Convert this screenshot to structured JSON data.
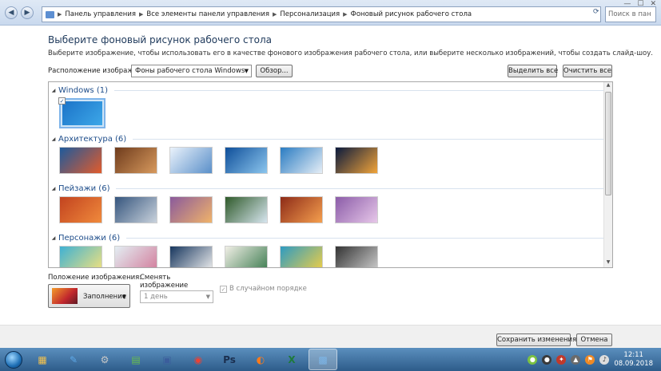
{
  "address": {
    "segments": [
      "Панель управления",
      "Все элементы панели управления",
      "Персонализация",
      "Фоновый рисунок рабочего стола"
    ],
    "search_placeholder": "Поиск в пан"
  },
  "main": {
    "title": "Выберите фоновый рисунок рабочего стола",
    "subtitle": "Выберите изображение, чтобы использовать его в качестве фонового изображения рабочего стола, или выберите несколько изображений, чтобы создать слайд-шоу.",
    "location_label": "Расположение изображения:",
    "location_value": "Фоны рабочего стола Windows",
    "browse_label": "Обзор...",
    "select_all_label": "Выделить все",
    "clear_all_label": "Очистить все"
  },
  "groups": [
    {
      "title": "Windows (1)",
      "thumbs": [
        {
          "colors": [
            "#1b73c8",
            "#3da7e8"
          ],
          "selected": true
        }
      ]
    },
    {
      "title": "Архитектура (6)",
      "thumbs": [
        {
          "colors": [
            "#1d5a9c",
            "#e25b2b"
          ]
        },
        {
          "colors": [
            "#6e3b1c",
            "#d89a5e"
          ]
        },
        {
          "colors": [
            "#eaf2fb",
            "#5a8fc9"
          ]
        },
        {
          "colors": [
            "#0f4f9a",
            "#8cc6ee"
          ]
        },
        {
          "colors": [
            "#2a7cc2",
            "#e6eef6"
          ]
        },
        {
          "colors": [
            "#0a1a3d",
            "#f1a43a"
          ]
        }
      ]
    },
    {
      "title": "Пейзажи (6)",
      "thumbs": [
        {
          "colors": [
            "#c2431f",
            "#f08a3c"
          ]
        },
        {
          "colors": [
            "#35557d",
            "#c9d2dc"
          ]
        },
        {
          "colors": [
            "#8a5a9c",
            "#f0b36a"
          ]
        },
        {
          "colors": [
            "#2f5a2a",
            "#d7e6ef"
          ]
        },
        {
          "colors": [
            "#8d2b18",
            "#f59f4e"
          ]
        },
        {
          "colors": [
            "#8b5ca8",
            "#e7c7e9"
          ]
        }
      ]
    },
    {
      "title": "Персонажи (6)",
      "thumbs": [
        {
          "colors": [
            "#3fb1d3",
            "#f4e27c"
          ]
        },
        {
          "colors": [
            "#e3eef3",
            "#d27b9a"
          ]
        },
        {
          "colors": [
            "#17365e",
            "#f0f0f0"
          ]
        },
        {
          "colors": [
            "#f1efe6",
            "#3b7a4e"
          ]
        },
        {
          "colors": [
            "#2e9bc2",
            "#f2cf43"
          ]
        },
        {
          "colors": [
            "#333333",
            "#cfcfcf"
          ]
        }
      ]
    }
  ],
  "bottom": {
    "position_label": "Положение изображения:",
    "position_value": "Заполнение",
    "change_label": "Сменять изображение каждые:",
    "interval_value": "1 день",
    "shuffle_label": "В случайном порядке"
  },
  "footer": {
    "save_label": "Сохранить изменения",
    "cancel_label": "Отмена"
  },
  "taskbar": {
    "tasks": [
      {
        "name": "explorer-task",
        "glyph": "▦",
        "color": "#f2c14e"
      },
      {
        "name": "paint-task",
        "glyph": "✎",
        "color": "#5ea9e8"
      },
      {
        "name": "tool-task",
        "glyph": "⚙",
        "color": "#c7c7c7"
      },
      {
        "name": "chart-task",
        "glyph": "▤",
        "color": "#6abf4b"
      },
      {
        "name": "save-task",
        "glyph": "▣",
        "color": "#3b5e9c"
      },
      {
        "name": "chrome-task",
        "glyph": "◉",
        "color": "#e94235"
      },
      {
        "name": "photoshop-task",
        "glyph": "Ps",
        "color": "#1b2f4f"
      },
      {
        "name": "firefox-task",
        "glyph": "◐",
        "color": "#ff7b1a"
      },
      {
        "name": "excel-task",
        "glyph": "X",
        "color": "#1d7a3a"
      },
      {
        "name": "control-panel-task",
        "glyph": "▩",
        "color": "#7db6e8"
      }
    ],
    "time": "12:11",
    "date": "08.09.2018"
  }
}
